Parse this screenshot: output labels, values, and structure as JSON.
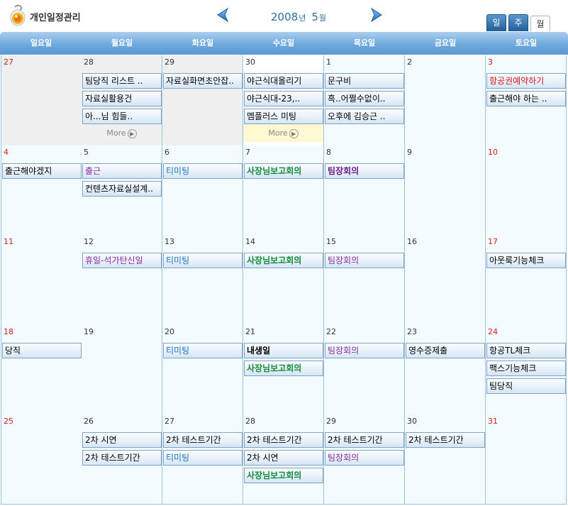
{
  "header": {
    "app_title": "개인일정관리",
    "year": "2008",
    "year_suffix": "년",
    "month": "5",
    "month_suffix": "월",
    "view_tabs": [
      "일",
      "주",
      "월"
    ]
  },
  "weekdays": [
    "일요일",
    "월요일",
    "화요일",
    "수요일",
    "목요일",
    "금요일",
    "토요일"
  ],
  "more_label": "More",
  "weeks": [
    {
      "days": [
        {
          "num": "27",
          "events": []
        },
        {
          "num": "28",
          "events": [
            {
              "t": "팀당직 리스트 .."
            },
            {
              "t": "자료실활용건"
            },
            {
              "t": "아...님 힘들.."
            }
          ],
          "more": true
        },
        {
          "num": "29",
          "events": [
            {
              "t": "자료실화면초안잡.."
            }
          ]
        },
        {
          "num": "30",
          "events": [
            {
              "t": "야근식대올리기"
            },
            {
              "t": "야근식대-23,.."
            },
            {
              "t": "멤플러스 미팅"
            }
          ],
          "more": true
        },
        {
          "num": "1",
          "events": [
            {
              "t": "문구비"
            },
            {
              "t": "흑..어쩔수없이.."
            },
            {
              "t": "오후에 김승근 .."
            }
          ]
        },
        {
          "num": "2",
          "events": []
        },
        {
          "num": "3",
          "events": [
            {
              "t": "항공권예약하기",
              "c": "red"
            },
            {
              "t": "출근해야 하는 .."
            }
          ]
        }
      ]
    },
    {
      "days": [
        {
          "num": "4",
          "events": [
            {
              "t": "출근해야겠지"
            }
          ]
        },
        {
          "num": "5",
          "events": [
            {
              "t": "출근",
              "c": "purple"
            },
            {
              "t": "컨텐츠자료실설계.."
            }
          ]
        },
        {
          "num": "6",
          "events": [
            {
              "t": "티미팅",
              "c": "blue"
            }
          ]
        },
        {
          "num": "7",
          "events": [
            {
              "t": "사장님보고회의",
              "c": "green"
            }
          ]
        },
        {
          "num": "8",
          "events": [
            {
              "t": "팀장회의",
              "c": "purple-b"
            }
          ]
        },
        {
          "num": "9",
          "events": []
        },
        {
          "num": "10",
          "events": []
        }
      ]
    },
    {
      "days": [
        {
          "num": "11",
          "events": []
        },
        {
          "num": "12",
          "events": [
            {
              "t": "휴일-석가탄신일",
              "c": "purple"
            }
          ]
        },
        {
          "num": "13",
          "events": [
            {
              "t": "티미팅",
              "c": "blue"
            }
          ]
        },
        {
          "num": "14",
          "events": [
            {
              "t": "사장님보고회의",
              "c": "green"
            }
          ]
        },
        {
          "num": "15",
          "events": [
            {
              "t": "팀장회의",
              "c": "purple"
            }
          ]
        },
        {
          "num": "16",
          "events": []
        },
        {
          "num": "17",
          "events": [
            {
              "t": "아웃룩기능체크"
            }
          ]
        }
      ]
    },
    {
      "days": [
        {
          "num": "18",
          "events": [
            {
              "t": "당직"
            }
          ]
        },
        {
          "num": "19",
          "events": []
        },
        {
          "num": "20",
          "events": [
            {
              "t": "티미팅",
              "c": "blue"
            }
          ]
        },
        {
          "num": "21",
          "events": [
            {
              "t": "내생일",
              "c": "bold"
            },
            {
              "t": "사장님보고회의",
              "c": "green"
            }
          ]
        },
        {
          "num": "22",
          "events": [
            {
              "t": "팀장회의",
              "c": "purple"
            }
          ]
        },
        {
          "num": "23",
          "events": [
            {
              "t": "영수증제출"
            }
          ]
        },
        {
          "num": "24",
          "events": [
            {
              "t": "항공TL체크"
            },
            {
              "t": "팩스기능체크"
            },
            {
              "t": "팀당직"
            }
          ]
        }
      ]
    },
    {
      "days": [
        {
          "num": "25",
          "events": []
        },
        {
          "num": "26",
          "events": [
            {
              "t": "2차 시연"
            },
            {
              "t": "2차 테스트기간"
            }
          ]
        },
        {
          "num": "27",
          "events": [
            {
              "t": "2차 테스트기간"
            },
            {
              "t": "티미팅",
              "c": "blue"
            }
          ]
        },
        {
          "num": "28",
          "events": [
            {
              "t": "2차 테스트기간"
            },
            {
              "t": "2차 시연"
            },
            {
              "t": "사장님보고회의",
              "c": "green"
            }
          ]
        },
        {
          "num": "29",
          "events": [
            {
              "t": "2차 테스트기간"
            },
            {
              "t": "팀장회의",
              "c": "purple"
            }
          ]
        },
        {
          "num": "30",
          "events": [
            {
              "t": "2차 테스트기간"
            }
          ]
        },
        {
          "num": "31",
          "events": []
        }
      ]
    }
  ]
}
